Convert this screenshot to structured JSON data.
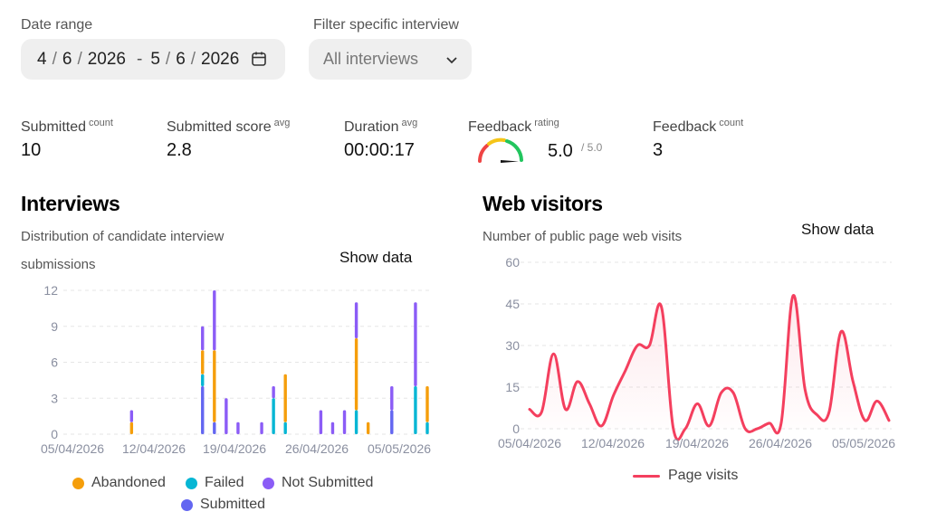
{
  "filters": {
    "date_range_label": "Date range",
    "start": {
      "month": "4",
      "day": "6",
      "year": "2026"
    },
    "end": {
      "month": "5",
      "day": "6",
      "year": "2026"
    },
    "separator": "/",
    "range_dash": "-",
    "interview_filter_label": "Filter specific interview",
    "interview_filter_value": "All interviews"
  },
  "stats": {
    "submitted": {
      "label": "Submitted",
      "sup": "count",
      "value": "10"
    },
    "score": {
      "label": "Submitted score",
      "sup": "avg",
      "value": "2.8"
    },
    "duration": {
      "label": "Duration",
      "sup": "avg",
      "value": "00:00:17"
    },
    "feedback_rating": {
      "label": "Feedback",
      "sup": "rating",
      "value": "5.0",
      "total": "/ 5.0",
      "fraction": 1.0
    },
    "feedback_count": {
      "label": "Feedback",
      "sup": "count",
      "value": "3"
    }
  },
  "interviews": {
    "title": "Interviews",
    "subtitle_line1": "Distribution of candidate interview",
    "subtitle_line2": "submissions",
    "show_data": "Show data"
  },
  "web_visitors": {
    "title": "Web visitors",
    "subtitle": "Number of public page web visits",
    "show_data": "Show data"
  },
  "colors": {
    "abandoned": "#f59e0b",
    "failed": "#06b6d4",
    "not_submitted": "#8b5cf6",
    "submitted": "#6366f1",
    "page_visits": "#f43f5e"
  },
  "chart_data": [
    {
      "type": "bar",
      "stacked": true,
      "x_ticks": [
        "05/04/2026",
        "12/04/2026",
        "19/04/2026",
        "26/04/2026",
        "05/05/2026"
      ],
      "y_ticks": [
        "0",
        "3",
        "6",
        "9",
        "12"
      ],
      "ylim": [
        0,
        12
      ],
      "grid": true,
      "legend_position": "bottom",
      "categories": [
        "d1",
        "d2",
        "d3",
        "d4",
        "d5",
        "d6",
        "d7",
        "d8",
        "d9",
        "d10",
        "d11",
        "d12",
        "d13",
        "d14",
        "d15",
        "d16",
        "d17",
        "d18",
        "d19",
        "d20",
        "d21",
        "d22",
        "d23",
        "d24",
        "d25",
        "d26",
        "d27",
        "d28",
        "d29",
        "d30",
        "d31"
      ],
      "series": [
        {
          "name": "Abandoned",
          "values": [
            0,
            0,
            0,
            0,
            0,
            1,
            0,
            0,
            0,
            0,
            0,
            2,
            6,
            0,
            0,
            0,
            0,
            0,
            4,
            0,
            0,
            0,
            0,
            0,
            6,
            1,
            0,
            0,
            0,
            0,
            3
          ]
        },
        {
          "name": "Failed",
          "values": [
            0,
            0,
            0,
            0,
            0,
            0,
            0,
            0,
            0,
            0,
            0,
            1,
            0,
            0,
            0,
            0,
            0,
            3,
            1,
            0,
            0,
            0,
            0,
            0,
            2,
            0,
            0,
            0,
            0,
            4,
            1
          ]
        },
        {
          "name": "Not Submitted",
          "values": [
            0,
            0,
            0,
            0,
            0,
            1,
            0,
            0,
            0,
            0,
            0,
            2,
            5,
            3,
            1,
            0,
            1,
            1,
            0,
            0,
            0,
            2,
            1,
            2,
            3,
            0,
            0,
            2,
            0,
            7,
            0
          ]
        },
        {
          "name": "Submitted",
          "values": [
            0,
            0,
            0,
            0,
            0,
            0,
            0,
            0,
            0,
            0,
            0,
            4,
            1,
            0,
            0,
            0,
            0,
            0,
            0,
            0,
            0,
            0,
            0,
            0,
            0,
            0,
            0,
            2,
            0,
            0,
            0
          ]
        }
      ]
    },
    {
      "type": "line",
      "x_ticks": [
        "05/04/2026",
        "12/04/2026",
        "19/04/2026",
        "26/04/2026",
        "05/05/2026"
      ],
      "y_ticks": [
        "0",
        "15",
        "30",
        "45",
        "60"
      ],
      "ylim": [
        0,
        60
      ],
      "grid": true,
      "legend_position": "bottom",
      "series": [
        {
          "name": "Page visits",
          "values": [
            7,
            6,
            27,
            7,
            17,
            9,
            1,
            12,
            21,
            30,
            30,
            44,
            0,
            0,
            9,
            1,
            13,
            13,
            0,
            0,
            2,
            2,
            48,
            14,
            5,
            6,
            35,
            17,
            3,
            10,
            3
          ]
        }
      ]
    }
  ]
}
